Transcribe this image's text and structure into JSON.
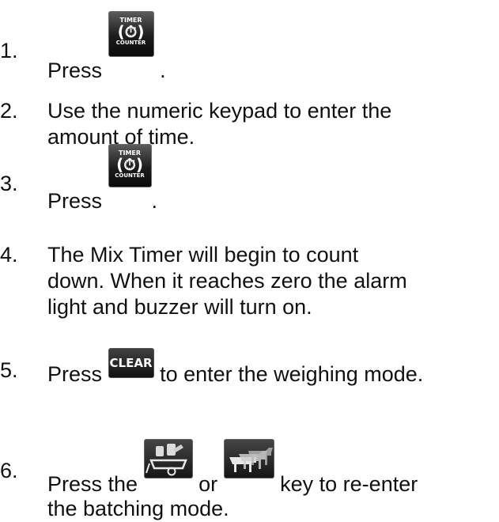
{
  "steps": [
    {
      "num": "1.",
      "before": "Press",
      "after": "."
    },
    {
      "num": "2.",
      "lines": [
        "Use the numeric keypad to enter the",
        "amount of time."
      ]
    },
    {
      "num": "3.",
      "before": "Press",
      "after": "."
    },
    {
      "num": "4.",
      "lines": [
        "The Mix Timer will begin to count",
        "down.  When it reaches zero the alarm",
        "light and buzzer will turn on."
      ]
    },
    {
      "num": "5.",
      "before": "Press",
      "after": "to enter the weighing mode."
    },
    {
      "num": "6.",
      "before": "Press the",
      "middle": "or",
      "after": "key to re-enter",
      "line2": "the batching mode."
    }
  ],
  "keys": {
    "timer_counter": {
      "top": "TIMER",
      "symbol": "(⏱)",
      "bottom": "COUNTER"
    },
    "clear": {
      "label": "CLEAR"
    },
    "batching_icon": "ingredient-cart-icon",
    "cattle_icon": "cattle-icon"
  }
}
